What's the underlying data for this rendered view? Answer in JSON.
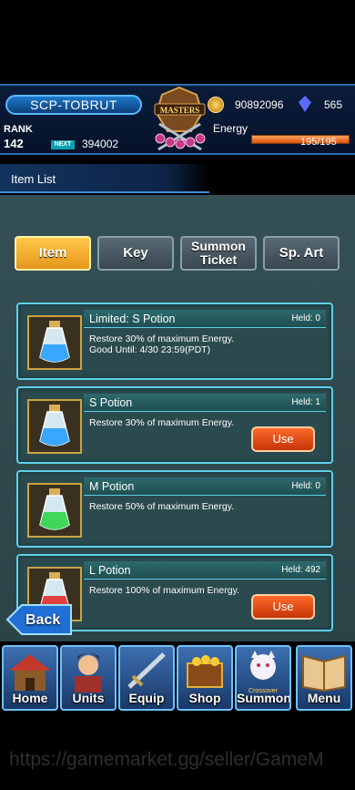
{
  "header": {
    "player_name": "SCP-TOBRUT",
    "rank_label": "RANK",
    "rank_value": "142",
    "next_label": "NEXT",
    "exp_value": "394002",
    "emblem_text": "MASTERS",
    "gold": "90892096",
    "gems": "565",
    "energy_label": "Energy",
    "energy_value": "195/195",
    "energy_fraction": 1.0
  },
  "subheader": {
    "title": "Item List"
  },
  "tabs": [
    {
      "label": "Item",
      "active": true
    },
    {
      "label": "Key",
      "active": false
    },
    {
      "label": "Summon Ticket",
      "active": false
    },
    {
      "label": "Sp. Art",
      "active": false
    }
  ],
  "items": [
    {
      "name": "Limited: S Potion",
      "held": "Held: 0",
      "desc": "Restore 30% of maximum Energy. Good Until: 4/30 23:59(PDT)",
      "potion_color": "#3aa7ff",
      "use": ""
    },
    {
      "name": "S Potion",
      "held": "Held: 1",
      "desc": "Restore 30% of maximum Energy.",
      "potion_color": "#3aa7ff",
      "use": "Use"
    },
    {
      "name": "M Potion",
      "held": "Held: 0",
      "desc": "Restore 50% of maximum Energy.",
      "potion_color": "#3fd65a",
      "use": ""
    },
    {
      "name": "L Potion",
      "held": "Held: 492",
      "desc": "Restore 100% of maximum Energy.",
      "potion_color": "#e24040",
      "use": "Use"
    }
  ],
  "back_label": "Back",
  "nav": [
    {
      "label": "Home",
      "tag": ""
    },
    {
      "label": "Units",
      "tag": ""
    },
    {
      "label": "Equip",
      "tag": ""
    },
    {
      "label": "Shop",
      "tag": ""
    },
    {
      "label": "Summon",
      "tag": "Crossover"
    },
    {
      "label": "Menu",
      "tag": ""
    }
  ],
  "watermark": "https://gamemarket.gg/seller/GameM"
}
